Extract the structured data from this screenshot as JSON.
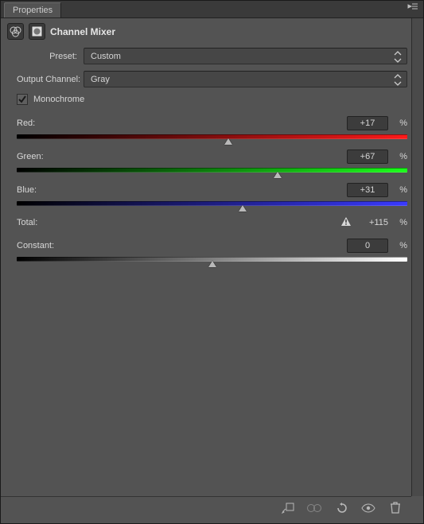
{
  "tab": {
    "label": "Properties"
  },
  "panel": {
    "title": "Channel Mixer"
  },
  "preset": {
    "label": "Preset:",
    "value": "Custom"
  },
  "output_channel": {
    "label": "Output Channel:",
    "value": "Gray"
  },
  "monochrome": {
    "label": "Monochrome",
    "checked": true
  },
  "sliders": {
    "red": {
      "label": "Red:",
      "value": "+17",
      "unit": "%",
      "pos_pct": 54.25
    },
    "green": {
      "label": "Green:",
      "value": "+67",
      "unit": "%",
      "pos_pct": 66.75
    },
    "blue": {
      "label": "Blue:",
      "value": "+31",
      "unit": "%",
      "pos_pct": 57.75
    },
    "constant": {
      "label": "Constant:",
      "value": "0",
      "unit": "%",
      "pos_pct": 50
    }
  },
  "total": {
    "label": "Total:",
    "value": "+115",
    "unit": "%",
    "warning": true
  }
}
